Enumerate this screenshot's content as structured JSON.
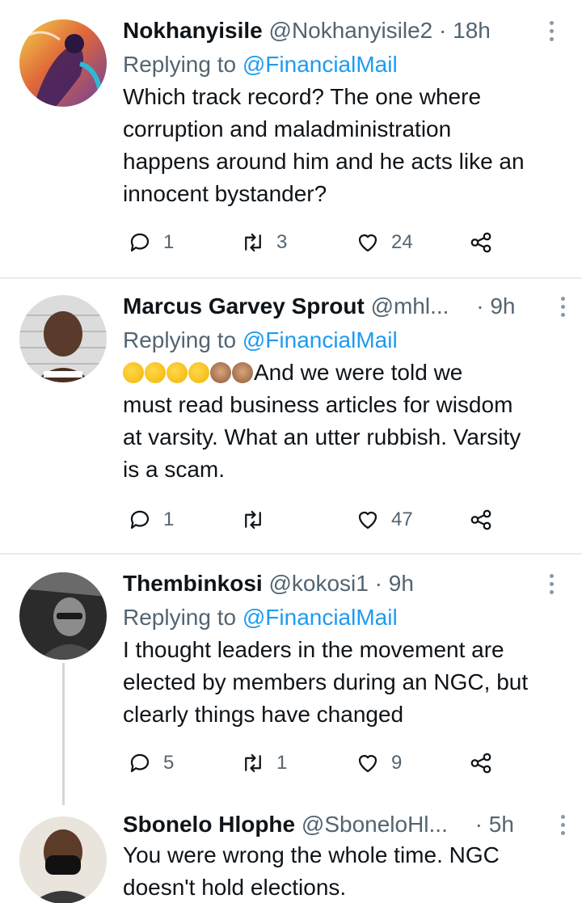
{
  "tweets": [
    {
      "name": "Nokhanyisile",
      "handle": "@Nokhanyisile2",
      "dot": "·",
      "time": "18h",
      "replying_prefix": "Replying to ",
      "replying_to": "@FinancialMail",
      "text_lines": [
        "Which track record? The one where",
        "corruption and maladministration",
        "happens around him and he acts like an",
        "innocent bystander?"
      ],
      "replies": "1",
      "retweets": "3",
      "likes": "24"
    },
    {
      "name": "Marcus Garvey Sprout",
      "handle": "@mhl...",
      "dot": "·",
      "time": "9h",
      "replying_prefix": "Replying to ",
      "replying_to": "@FinancialMail",
      "emoji_names": [
        "rolling-on-floor-laughing-emoji",
        "rolling-on-floor-laughing-emoji",
        "rolling-on-floor-laughing-emoji",
        "joy-emoji",
        "see-no-evil-monkey-emoji",
        "see-no-evil-monkey-emoji"
      ],
      "text_lines": [
        "And we were told we",
        "must read business articles for wisdom",
        "at varsity. What an utter rubbish. Varsity",
        "is a scam."
      ],
      "replies": "1",
      "retweets": "",
      "likes": "47"
    },
    {
      "name": "Thembinkosi",
      "handle": "@kokosi1",
      "dot": "·",
      "time": "9h",
      "replying_prefix": "Replying to ",
      "replying_to": "@FinancialMail",
      "text_lines": [
        "I thought leaders in the movement are",
        "elected by members during an NGC,  but",
        "clearly things have changed"
      ],
      "replies": "5",
      "retweets": "1",
      "likes": "9"
    },
    {
      "name": "Sbonelo Hlophe",
      "handle": "@SboneloHl...",
      "dot": "·",
      "time": "5h",
      "text_lines": [
        "You were wrong the whole time. NGC",
        "doesn't hold elections."
      ]
    }
  ],
  "icons": {
    "reply": "reply-icon",
    "retweet": "retweet-icon",
    "like": "heart-icon",
    "share": "share-icon",
    "more": "more-vertical-icon"
  },
  "colors": {
    "text": "#0f1419",
    "secondary": "#536471",
    "link": "#1d9bf0",
    "divider": "#e6ecf0",
    "thread_line": "#cfd9de"
  }
}
